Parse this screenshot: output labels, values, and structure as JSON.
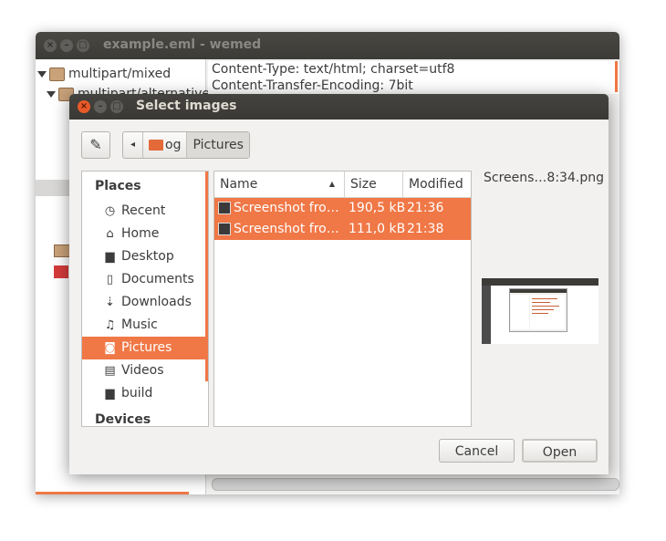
{
  "bg_window": {
    "title": "example.eml - wemed",
    "tree": [
      "multipart/mixed",
      "multipart/alternative"
    ],
    "headers": [
      "Content-Type: text/html; charset=utf8",
      "Content-Transfer-Encoding: 7bit"
    ]
  },
  "dialog": {
    "title": "Select images",
    "path_segments": [
      "og",
      "Pictures"
    ],
    "places_header": "Places",
    "devices_header": "Devices",
    "places": [
      {
        "label": "Recent",
        "icon": "clock-icon"
      },
      {
        "label": "Home",
        "icon": "home-icon"
      },
      {
        "label": "Desktop",
        "icon": "folder-icon"
      },
      {
        "label": "Documents",
        "icon": "document-icon"
      },
      {
        "label": "Downloads",
        "icon": "download-icon"
      },
      {
        "label": "Music",
        "icon": "music-icon"
      },
      {
        "label": "Pictures",
        "icon": "camera-icon"
      },
      {
        "label": "Videos",
        "icon": "film-icon"
      },
      {
        "label": "build",
        "icon": "folder-icon"
      }
    ],
    "columns": {
      "name": "Name",
      "size": "Size",
      "modified": "Modified"
    },
    "files": [
      {
        "name": "Screenshot fro…",
        "size": "190,5 kB",
        "modified": "21:36"
      },
      {
        "name": "Screenshot fro…",
        "size": "111,0 kB",
        "modified": "21:38"
      }
    ],
    "preview_name": "Screens…8:34.png",
    "cancel_label": "Cancel",
    "open_label": "Open"
  }
}
